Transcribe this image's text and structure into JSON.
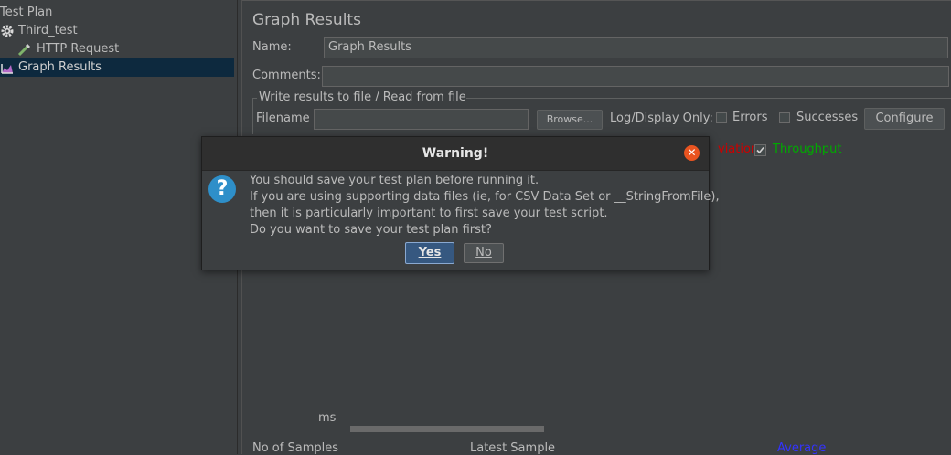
{
  "tree": {
    "items": [
      {
        "label": "Test Plan",
        "icon": "test-plan-icon"
      },
      {
        "label": "Third_test",
        "icon": "gear-icon"
      },
      {
        "label": "HTTP Request",
        "icon": "pipette-icon"
      },
      {
        "label": "Graph Results",
        "icon": "graph-icon",
        "selected": true
      }
    ]
  },
  "panel": {
    "title": "Graph Results",
    "name_label": "Name:",
    "name_value": "Graph Results",
    "comments_label": "Comments:",
    "comments_value": "",
    "fileset_legend": "Write results to file / Read from file",
    "filename_label": "Filename",
    "filename_value": "",
    "browse_label": "Browse...",
    "log_display_label": "Log/Display Only:",
    "errors_label": "Errors",
    "successes_label": "Successes",
    "configure_label": "Configure",
    "deviation_label": "viation",
    "throughput_label": "Throughput",
    "throughput_checked": true,
    "ms_label": "ms",
    "footer_samples": "No of Samples",
    "footer_latest": "Latest Sample",
    "footer_average": "Average"
  },
  "dialog": {
    "title": "Warning!",
    "lines": [
      "You should save your test plan before running it.",
      "If you are using supporting data files (ie, for CSV Data Set or __StringFromFile),",
      "then it is particularly important to first save your test script.",
      "Do you want to save your test plan first?"
    ],
    "yes_label": "Yes",
    "no_label": "No"
  },
  "colors": {
    "background": "#3c3f41",
    "selection": "#0d293e",
    "accent_close": "#e95420",
    "question_icon": "#2e8fc9",
    "deviation": "#cc0000",
    "throughput": "#00aa00",
    "average": "#3333ff"
  }
}
